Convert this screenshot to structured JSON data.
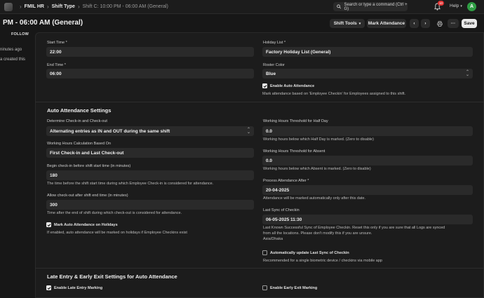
{
  "navbar": {
    "breadcrumbs": [
      "FMIL HR",
      "Shift Type",
      "Shift C: 10:00 PM - 06:00 AM (General)"
    ],
    "search_placeholder": "Search or type a command (Ctrl + G)",
    "notification_count": "10",
    "help_label": "Help",
    "avatar_initial": "A"
  },
  "page": {
    "title": "PM - 06:00 AM (General)",
    "shift_tools_label": "Shift Tools",
    "mark_attendance_label": "Mark Attendance",
    "save_label": "Save"
  },
  "sidebar": {
    "follow_label": "FOLLOW",
    "timeline_1": "ninutes ago",
    "timeline_2": "a created this"
  },
  "form": {
    "start_time": {
      "label": "Start Time *",
      "value": "22:00"
    },
    "end_time": {
      "label": "End Time *",
      "value": "06:00"
    },
    "holiday_list": {
      "label": "Holiday List *",
      "value": "Factory Holiday List (General)"
    },
    "roster_color": {
      "label": "Roster Color",
      "value": "Blue"
    },
    "enable_auto_attendance": {
      "label": "Enable Auto Attendance",
      "checked": true,
      "description": "Mark attendance based on 'Employee Checkin' for Employees assigned to this shift."
    },
    "auto_section_title": "Auto Attendance Settings",
    "determine_checkin": {
      "label": "Determine Check-in and Check-out",
      "value": "Alternating entries as IN and OUT during the same shift"
    },
    "working_hours_calc": {
      "label": "Working Hours Calculation Based On",
      "value": "First Check-in and Last Check-out"
    },
    "begin_checkin": {
      "label": "Begin check-in before shift start time (in minutes)",
      "value": "180",
      "description": "The time before the shift start time during which Employee Check-in is considered for attendance."
    },
    "allow_checkout": {
      "label": "Allow check-out after shift end time (in minutes)",
      "value": "300",
      "description": "Time after the end of shift during which check-out is considered for attendance."
    },
    "mark_on_holidays": {
      "label": "Mark Auto Attendance on Holidays",
      "checked": true,
      "description": "If enabled, auto attendance will be marked on holidays if Employee Checkins exist"
    },
    "half_day_threshold": {
      "label": "Working Hours Threshold for Half Day",
      "value": "0.0",
      "description": "Working hours below which Half Day is marked. (Zero to disable)"
    },
    "absent_threshold": {
      "label": "Working Hours Threshold for Absent",
      "value": "0.0",
      "description": "Working hours below which Absent is marked. (Zero to disable)"
    },
    "process_after": {
      "label": "Process Attendance After *",
      "value": "20-04-2025",
      "description": "Attendance will be marked automatically only after this date."
    },
    "last_sync": {
      "label": "Last Sync of Checkin",
      "value": "06-05-2025 11:30",
      "description_1": "Last Known Successful Sync of Employee Checkin. Reset this only if you are sure that all Logs are synced",
      "description_2": "from all the locations. Please don't modify this if you are unsure.",
      "timezone": "Asia/Dhaka"
    },
    "auto_update_sync": {
      "label": "Automatically update Last Sync of Checkin",
      "checked": false,
      "description": "Recommended for a single biometric device / checkins via mobile app"
    },
    "late_section_title": "Late Entry & Early Exit Settings for Auto Attendance",
    "enable_late_entry": {
      "label": "Enable Late Entry Marking",
      "checked": true
    },
    "enable_early_exit": {
      "label": "Enable Early Exit Marking",
      "checked": false
    }
  }
}
